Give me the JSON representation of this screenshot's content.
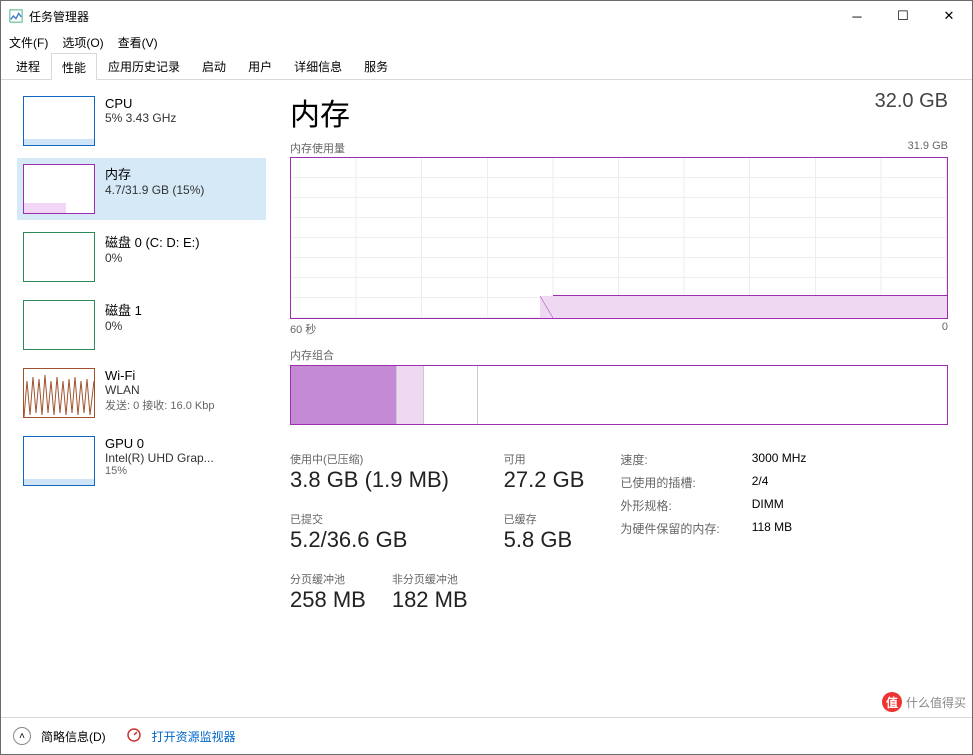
{
  "window": {
    "title": "任务管理器"
  },
  "menu": {
    "file": "文件(F)",
    "options": "选项(O)",
    "view": "查看(V)"
  },
  "tabs": {
    "processes": "进程",
    "performance": "性能",
    "history": "应用历史记录",
    "startup": "启动",
    "users": "用户",
    "details": "详细信息",
    "services": "服务"
  },
  "sidebar": {
    "cpu": {
      "title": "CPU",
      "sub": "5%  3.43 GHz"
    },
    "mem": {
      "title": "内存",
      "sub": "4.7/31.9 GB (15%)"
    },
    "disk0": {
      "title": "磁盘 0 (C: D: E:)",
      "sub": "0%"
    },
    "disk1": {
      "title": "磁盘 1",
      "sub": "0%"
    },
    "wifi": {
      "title": "Wi-Fi",
      "sub": "WLAN",
      "sub2": "发送: 0 接收: 16.0 Kbp"
    },
    "gpu": {
      "title": "GPU 0",
      "sub": "Intel(R) UHD Grap...",
      "sub2": "15%"
    }
  },
  "detail": {
    "title": "内存",
    "total": "32.0 GB",
    "usage_label": "内存使用量",
    "usage_max": "31.9 GB",
    "axis_left": "60 秒",
    "axis_right": "0",
    "comp_label": "内存组合",
    "stats": {
      "in_use_lbl": "使用中(已压缩)",
      "in_use_val": "3.8 GB (1.9 MB)",
      "avail_lbl": "可用",
      "avail_val": "27.2 GB",
      "committed_lbl": "已提交",
      "committed_val": "5.2/36.6 GB",
      "cached_lbl": "已缓存",
      "cached_val": "5.8 GB",
      "paged_lbl": "分页缓冲池",
      "paged_val": "258 MB",
      "nonpaged_lbl": "非分页缓冲池",
      "nonpaged_val": "182 MB"
    },
    "kv": {
      "speed_k": "速度:",
      "speed_v": "3000 MHz",
      "slots_k": "已使用的插槽:",
      "slots_v": "2/4",
      "form_k": "外形规格:",
      "form_v": "DIMM",
      "reserved_k": "为硬件保留的内存:",
      "reserved_v": "118 MB"
    }
  },
  "footer": {
    "fewer": "简略信息(D)",
    "resmon": "打开资源监视器"
  },
  "watermark": {
    "badge": "值",
    "text": "什么值得买"
  },
  "chart_data": {
    "type": "area",
    "title": "内存使用量",
    "xlabel": "60 秒",
    "x_right": "0",
    "ylabel": "",
    "ylim": [
      0,
      31.9
    ],
    "y_unit": "GB",
    "x": [
      60,
      55,
      50,
      45,
      40,
      37,
      36,
      35,
      30,
      25,
      20,
      15,
      10,
      5,
      0
    ],
    "values": [
      0,
      0,
      0,
      0,
      0,
      0,
      2.5,
      4.7,
      4.7,
      4.7,
      4.6,
      4.6,
      4.6,
      4.6,
      4.6
    ],
    "composition": {
      "in_use_gb": 3.8,
      "modified_gb": 0.9,
      "standby_gb": 5.8,
      "free_gb": 21.4
    }
  }
}
